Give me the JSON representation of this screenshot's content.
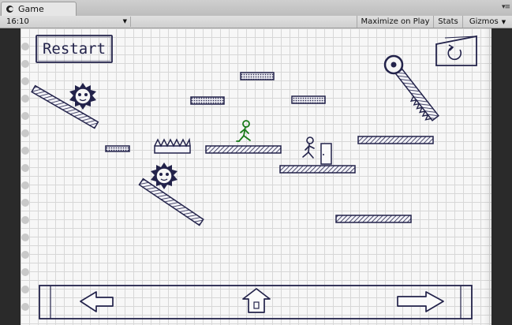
{
  "window": {
    "tab_label": "Game",
    "tab_menu_icon": "kebab-menu-icon"
  },
  "toolbar": {
    "aspect": "16:10",
    "maximize_label": "Maximize on Play",
    "stats_label": "Stats",
    "gizmos_label": "Gizmos"
  },
  "game": {
    "restart_label": "Restart",
    "colors": {
      "ink": "#22224a",
      "player": "#1a7a1a",
      "paper": "#f7f7f7",
      "grid": "#d7d7d7"
    },
    "icons": {
      "reset": "reset-icon",
      "left": "left-arrow-icon",
      "jump": "up-arrow-icon",
      "right": "right-arrow-icon"
    }
  }
}
